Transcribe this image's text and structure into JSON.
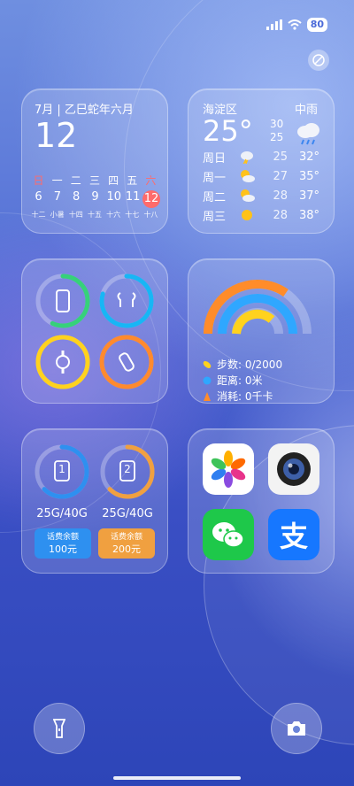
{
  "status": {
    "battery": "80"
  },
  "calendar": {
    "title": "7月 | 乙巳蛇年六月",
    "day": "12",
    "weekdays": [
      "日",
      "一",
      "二",
      "三",
      "四",
      "五",
      "六"
    ],
    "dates": [
      "6",
      "7",
      "8",
      "9",
      "10",
      "11",
      "12"
    ],
    "lunar": [
      "十二",
      "小暑",
      "十四",
      "十五",
      "十六",
      "十七",
      "十八"
    ]
  },
  "weather": {
    "location": "海淀区",
    "condition": "中雨",
    "temp": "25°",
    "high": "30",
    "low": "25",
    "forecast": [
      {
        "day": "周日",
        "icon": "thunder-rain-icon",
        "low": "25",
        "high": "32°"
      },
      {
        "day": "周一",
        "icon": "partly-cloudy-icon",
        "low": "27",
        "high": "35°"
      },
      {
        "day": "周二",
        "icon": "partly-cloudy-icon",
        "low": "28",
        "high": "37°"
      },
      {
        "day": "周三",
        "icon": "sunny-icon",
        "low": "28",
        "high": "38°"
      }
    ]
  },
  "activity": {
    "steps": "步数: 0/2000",
    "distance": "距离: 0米",
    "calories": "消耗: 0千卡",
    "colors": {
      "steps": "#ff8c2a",
      "distance": "#2fa7ff",
      "calories": "#ffd21e"
    }
  },
  "devices": {
    "items": [
      {
        "name": "phone-icon",
        "color": "#36d17a"
      },
      {
        "name": "earbuds-icon",
        "color": "#17b6f5"
      },
      {
        "name": "watch-icon",
        "color": "#ffd21e"
      },
      {
        "name": "band-icon",
        "color": "#ff8a2e"
      }
    ]
  },
  "sim": {
    "cards": [
      {
        "slot": "1",
        "data": "25G/40G",
        "fee_label": "话费余额",
        "fee": "100元",
        "color": "#2e90f0"
      },
      {
        "slot": "2",
        "data": "25G/40G",
        "fee_label": "话费余额",
        "fee": "200元",
        "color": "#f0a040"
      }
    ]
  },
  "apps": [
    {
      "name": "photos-app-icon"
    },
    {
      "name": "camera-app-icon"
    },
    {
      "name": "wechat-app-icon"
    },
    {
      "name": "alipay-app-icon",
      "glyph": "支"
    }
  ],
  "dock": {
    "left": "flashlight-icon",
    "right": "camera-icon"
  }
}
